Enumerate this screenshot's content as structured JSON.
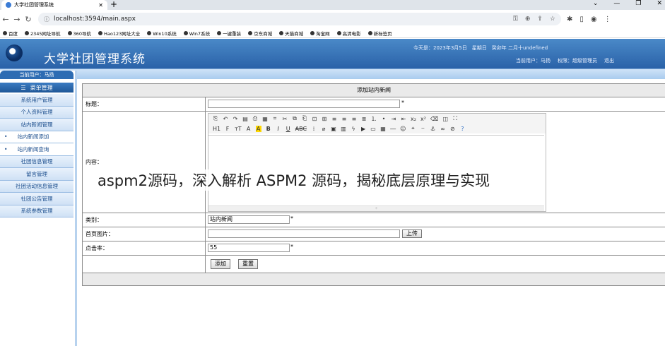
{
  "browser": {
    "tab_title": "大学社团管理系统",
    "url": "localhost:3594/main.aspx",
    "bookmarks": [
      "百度",
      "2345网址导航",
      "360导航",
      "Hao123网址大全",
      "Win10系统",
      "Win7系统",
      "一键重装",
      "京东商城",
      "天猫商城",
      "淘宝网",
      "高清电影",
      "新标签页"
    ]
  },
  "app": {
    "title": "大学社团管理系统",
    "today": "今天是：2023年3月5日　星期日　癸卯年 二月十undefined",
    "current_user": "当前用户：马扬",
    "role": "权限：超级管理员",
    "logout": "退出"
  },
  "sidebar": {
    "user_label": "当前用户：马扬",
    "menu_header": "菜单管理",
    "items": [
      "系统用户管理",
      "个人资料管理",
      "站内新闻管理",
      "站内新闻添加",
      "站内新闻查询",
      "社团信息管理",
      "留言管理",
      "社团活动信息管理",
      "社团公告管理",
      "系统参数管理"
    ]
  },
  "form": {
    "panel_title": "添加站内新闻",
    "title_label": "标题：",
    "content_label": "内容：",
    "category_label": "类别：",
    "category_value": "站内新闻",
    "image_label": "首页图片：",
    "upload_button": "上传",
    "clicks_label": "点击率：",
    "clicks_value": "55",
    "add_button": "添加",
    "reset_button": "重置",
    "required_mark": "*"
  },
  "overlay_caption": "aspm2源码，深入解析 ASPM2 源码，揭秘底层原理与实现"
}
